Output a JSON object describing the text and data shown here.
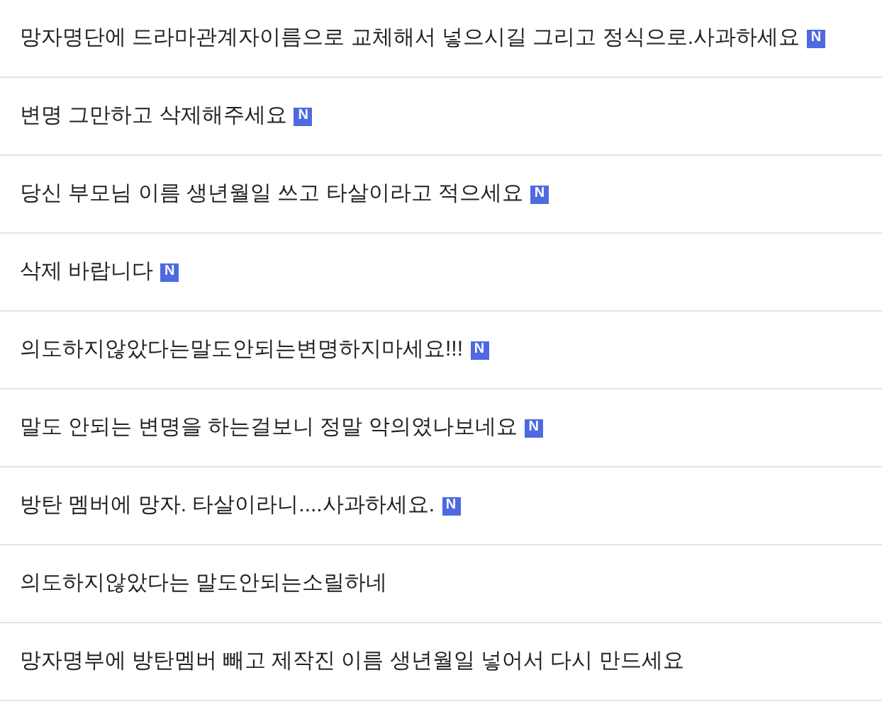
{
  "posts": [
    {
      "title": "망자명단에 드라마관계자이름으로 교체해서 넣으시길 그리고 정식으로.사과하세요",
      "new": true,
      "badge": "N"
    },
    {
      "title": "변명 그만하고 삭제해주세요",
      "new": true,
      "badge": "N"
    },
    {
      "title": "당신 부모님 이름 생년월일 쓰고 타살이라고 적으세요",
      "new": true,
      "badge": "N"
    },
    {
      "title": "삭제 바랍니다",
      "new": true,
      "badge": "N"
    },
    {
      "title": "의도하지않았다는말도안되는변명하지마세요!!!",
      "new": true,
      "badge": "N"
    },
    {
      "title": "말도 안되는 변명을 하는걸보니 정말 악의였나보네요",
      "new": true,
      "badge": "N"
    },
    {
      "title": "방탄 멤버에 망자. 타살이라니....사과하세요.",
      "new": true,
      "badge": "N"
    },
    {
      "title": "의도하지않았다는 말도안되는소릴하네",
      "new": false
    },
    {
      "title": "망자명부에 방탄멤버 빼고 제작진 이름 생년월일 넣어서 다시 만드세요",
      "new": false
    }
  ]
}
